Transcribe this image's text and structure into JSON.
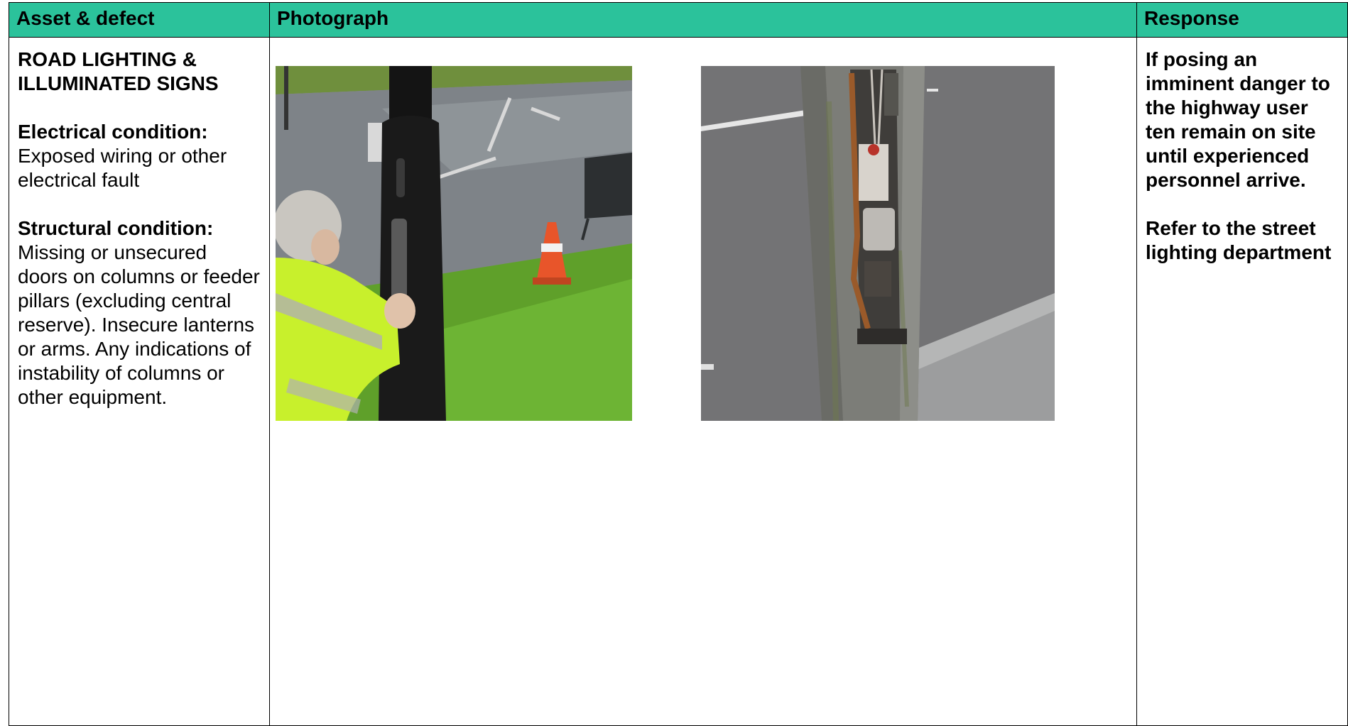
{
  "headers": {
    "asset": "Asset & defect",
    "photo": "Photograph",
    "response": "Response"
  },
  "asset": {
    "title": "ROAD LIGHTING & ILLUMINATED SIGNS",
    "electrical_heading": "Electrical condition:",
    "electrical_text": "Exposed wiring or other electrical fault",
    "structural_heading": "Structural condition:",
    "structural_text": "Missing or unsecured doors on columns or feeder pillars (excluding central reserve). Insecure lanterns or arms. Any indications of instability of columns or other equipment."
  },
  "response": {
    "para1": "If posing an imminent danger to the highway user ten remain on site until experienced personnel arrive.",
    "para2": "Refer to the street lighting department"
  },
  "colors": {
    "header_bg": "#2bc29b"
  }
}
